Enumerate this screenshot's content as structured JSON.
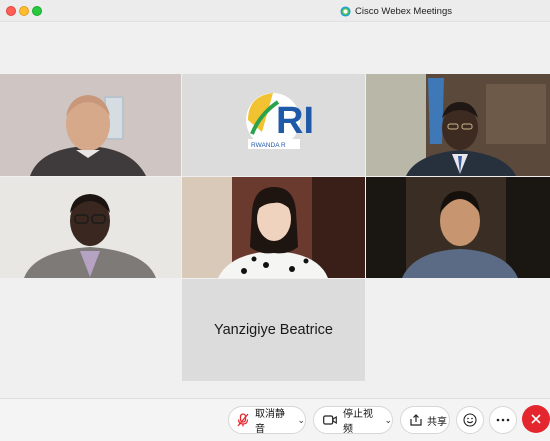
{
  "window": {
    "title": "Cisco Webex Meetings"
  },
  "participants": {
    "name_only_tile": "Yanzigiye Beatrice",
    "logo_text": "RWANDA R"
  },
  "toolbar": {
    "unmute_label": "取消静音",
    "stop_video_label": "停止视频",
    "share_label": "共享"
  },
  "icons": {
    "unmute": "mic-muted-icon",
    "video": "video-camera-icon",
    "share": "share-icon",
    "reactions": "smiley-icon",
    "more": "more-icon",
    "leave": "close-icon"
  },
  "colors": {
    "leave_button": "#e4272e",
    "muted_mic": "#e4272e",
    "tile_empty": "#dcdcdc"
  }
}
